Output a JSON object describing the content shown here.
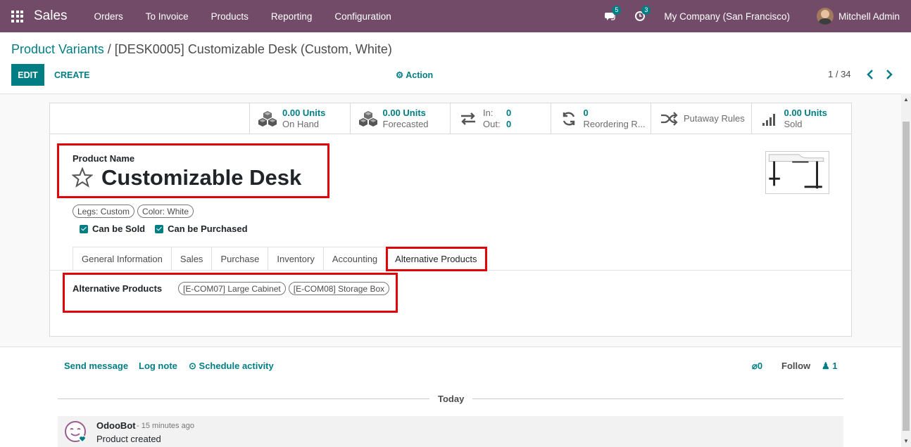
{
  "navbar": {
    "app_name": "Sales",
    "menu": [
      "Orders",
      "To Invoice",
      "Products",
      "Reporting",
      "Configuration"
    ],
    "messages_badge": "5",
    "activities_badge": "3",
    "company": "My Company (San Francisco)",
    "user": "Mitchell Admin"
  },
  "control_panel": {
    "breadcrumb_parent": "Product Variants",
    "breadcrumb_separator": " / ",
    "breadcrumb_current": "[DESK0005] Customizable Desk (Custom, White)",
    "edit_label": "EDIT",
    "create_label": "CREATE",
    "action_label": "Action",
    "pager": "1 / 34"
  },
  "stat_buttons": [
    {
      "value": "0.00 Units",
      "label": "On Hand",
      "icon": "cubes-icon"
    },
    {
      "value": "0.00 Units",
      "label": "Forecasted",
      "icon": "cubes-icon"
    },
    {
      "in_label": "In:",
      "in_value": "0",
      "out_label": "Out:",
      "out_value": "0",
      "icon": "exchange-icon"
    },
    {
      "value": "0",
      "label": "Reordering R...",
      "icon": "refresh-icon"
    },
    {
      "label": "Putaway Rules",
      "icon": "random-icon"
    },
    {
      "value": "0.00 Units",
      "label": "Sold",
      "icon": "signal-icon"
    }
  ],
  "form": {
    "name_label": "Product Name",
    "name": "Customizable Desk",
    "attributes": [
      "Legs: Custom",
      "Color: White"
    ],
    "can_be_sold": "Can be Sold",
    "can_be_purchased": "Can be Purchased",
    "tabs": [
      "General Information",
      "Sales",
      "Purchase",
      "Inventory",
      "Accounting",
      "Alternative Products"
    ],
    "active_tab": "Alternative Products",
    "alternative_label": "Alternative Products",
    "alternative_products": [
      "[E-COM07] Large Cabinet",
      "[E-COM08] Storage Box"
    ]
  },
  "chatter": {
    "send_message": "Send message",
    "log_note": "Log note",
    "schedule_activity": "Schedule activity",
    "attachments_count": "0",
    "follow": "Follow",
    "followers_count": "1",
    "date_separator": "Today",
    "message": {
      "author": "OdooBot",
      "time": "- 15 minutes ago",
      "body": "Product created"
    }
  },
  "colors": {
    "navbar": "#714b67",
    "primary": "#017e84",
    "highlight": "#e0040b"
  }
}
